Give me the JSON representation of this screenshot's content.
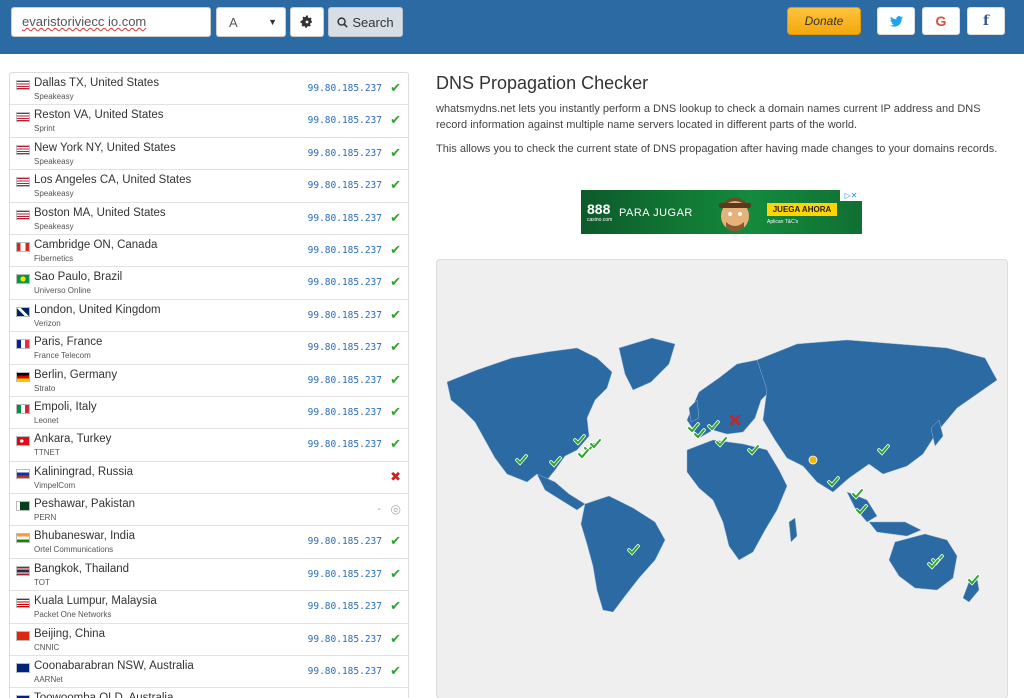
{
  "search": {
    "domain": "evaristoriviecc io.com",
    "record_type": "A",
    "search_label": "Search"
  },
  "header": {
    "donate_label": "Donate",
    "twitter_glyph": "t",
    "google_glyph": "G",
    "facebook_glyph": "f"
  },
  "colors": {
    "header_bg": "#2c6aa4",
    "map_land": "#2c6aa4",
    "ok": "#2da52d",
    "fail": "#cc2222",
    "ip": "#2a6db5"
  },
  "page": {
    "title": "DNS Propagation Checker",
    "intro": "whatsmydns.net lets you instantly perform a DNS lookup to check a domain names current IP address and DNS record information against multiple name servers located in different parts of the world.",
    "intro2": "This allows you to check the current state of DNS propagation after having made changes to your domains records."
  },
  "ad": {
    "logo": "888",
    "logo_sub": "casino.com",
    "tagline": "PARA JUGAR",
    "cta": "JUEGA AHORA",
    "small": "Aplican T&C's"
  },
  "servers": [
    {
      "location": "Dallas TX, United States",
      "provider": "Speakeasy",
      "ip": "99.80.185.237",
      "status": "ok",
      "flag": "us"
    },
    {
      "location": "Reston VA, United States",
      "provider": "Sprint",
      "ip": "99.80.185.237",
      "status": "ok",
      "flag": "us"
    },
    {
      "location": "New York NY, United States",
      "provider": "Speakeasy",
      "ip": "99.80.185.237",
      "status": "ok",
      "flag": "us"
    },
    {
      "location": "Los Angeles CA, United States",
      "provider": "Speakeasy",
      "ip": "99.80.185.237",
      "status": "ok",
      "flag": "us"
    },
    {
      "location": "Boston MA, United States",
      "provider": "Speakeasy",
      "ip": "99.80.185.237",
      "status": "ok",
      "flag": "us"
    },
    {
      "location": "Cambridge ON, Canada",
      "provider": "Fibernetics",
      "ip": "99.80.185.237",
      "status": "ok",
      "flag": "ca"
    },
    {
      "location": "Sao Paulo, Brazil",
      "provider": "Universo Online",
      "ip": "99.80.185.237",
      "status": "ok",
      "flag": "br"
    },
    {
      "location": "London, United Kingdom",
      "provider": "Verizon",
      "ip": "99.80.185.237",
      "status": "ok",
      "flag": "gb"
    },
    {
      "location": "Paris, France",
      "provider": "France Telecom",
      "ip": "99.80.185.237",
      "status": "ok",
      "flag": "fr"
    },
    {
      "location": "Berlin, Germany",
      "provider": "Strato",
      "ip": "99.80.185.237",
      "status": "ok",
      "flag": "de"
    },
    {
      "location": "Empoli, Italy",
      "provider": "Leonet",
      "ip": "99.80.185.237",
      "status": "ok",
      "flag": "it"
    },
    {
      "location": "Ankara, Turkey",
      "provider": "TTNET",
      "ip": "99.80.185.237",
      "status": "ok",
      "flag": "tr"
    },
    {
      "location": "Kaliningrad, Russia",
      "provider": "VimpelCom",
      "ip": "",
      "status": "fail",
      "flag": "ru"
    },
    {
      "location": "Peshawar, Pakistan",
      "provider": "PERN",
      "ip": "-",
      "status": "pending",
      "flag": "pk"
    },
    {
      "location": "Bhubaneswar, India",
      "provider": "Ortel Communications",
      "ip": "99.80.185.237",
      "status": "ok",
      "flag": "in"
    },
    {
      "location": "Bangkok, Thailand",
      "provider": "TOT",
      "ip": "99.80.185.237",
      "status": "ok",
      "flag": "th"
    },
    {
      "location": "Kuala Lumpur, Malaysia",
      "provider": "Packet One Networks",
      "ip": "99.80.185.237",
      "status": "ok",
      "flag": "my"
    },
    {
      "location": "Beijing, China",
      "provider": "CNNIC",
      "ip": "99.80.185.237",
      "status": "ok",
      "flag": "cn"
    },
    {
      "location": "Coonabarabran NSW, Australia",
      "provider": "AARNet",
      "ip": "99.80.185.237",
      "status": "ok",
      "flag": "au"
    },
    {
      "location": "Toowoomba QLD, Australia",
      "provider": "",
      "ip": "",
      "status": "",
      "flag": "au"
    }
  ],
  "map_markers": [
    {
      "name": "los-angeles",
      "status": "ok"
    },
    {
      "name": "dallas",
      "status": "ok"
    },
    {
      "name": "cambridge-on",
      "status": "ok"
    },
    {
      "name": "new-york",
      "status": "ok"
    },
    {
      "name": "boston",
      "status": "ok"
    },
    {
      "name": "reston",
      "status": "ok"
    },
    {
      "name": "sao-paulo",
      "status": "ok"
    },
    {
      "name": "london",
      "status": "ok"
    },
    {
      "name": "paris",
      "status": "ok"
    },
    {
      "name": "berlin",
      "status": "ok"
    },
    {
      "name": "empoli",
      "status": "ok"
    },
    {
      "name": "ankara",
      "status": "ok"
    },
    {
      "name": "kaliningrad",
      "status": "fail"
    },
    {
      "name": "peshawar",
      "status": "pending"
    },
    {
      "name": "bhubaneswar",
      "status": "ok"
    },
    {
      "name": "bangkok",
      "status": "ok"
    },
    {
      "name": "kuala-lumpur",
      "status": "ok"
    },
    {
      "name": "beijing",
      "status": "ok"
    },
    {
      "name": "coonabarabran",
      "status": "ok"
    },
    {
      "name": "toowoomba",
      "status": "ok"
    },
    {
      "name": "new-zealand",
      "status": "ok"
    }
  ]
}
